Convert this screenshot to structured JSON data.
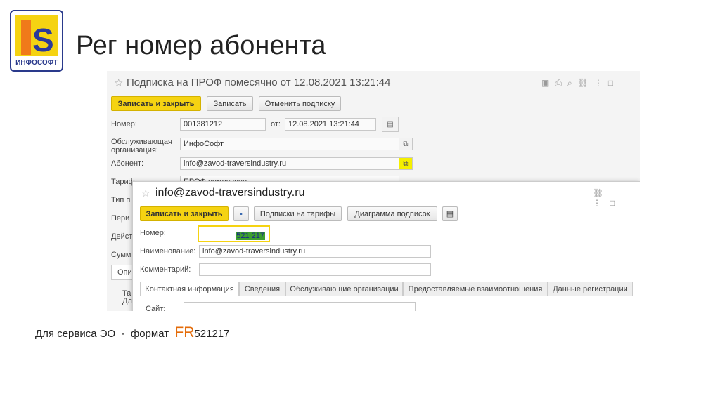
{
  "logo": {
    "text": "ИНФОСОФТ",
    "letters": "IS"
  },
  "slide_title": "Рег номер абонента",
  "main_form": {
    "title": "Подписка на ПРОФ помесячно от 12.08.2021 13:21:44",
    "buttons": {
      "save_close": "Записать и закрыть",
      "save": "Записать",
      "cancel_sub": "Отменить подписку"
    },
    "number_label": "Номер:",
    "number_value": "001381212",
    "from_label": "от:",
    "date_value": "12.08.2021 13:21:44",
    "org_label": "Обслуживающая организация:",
    "org_value": "ИнфоСофт",
    "subscriber_label": "Абонент:",
    "subscriber_value": "info@zavod-traversindustry.ru",
    "tariff_label": "Тариф",
    "tariff_value": "ПРОФ помесячно",
    "hidden_labels": [
      "Тип п",
      "Пери",
      "Дейст",
      "Сумм"
    ],
    "tab_partial": "Опи",
    "table_partial": [
      "Та",
      "Дл"
    ]
  },
  "sub_form": {
    "title": "info@zavod-traversindustry.ru",
    "buttons": {
      "save_close": "Записать и закрыть",
      "tariffs": "Подписки на тарифы",
      "diagram": "Диаграмма подписок"
    },
    "number_label": "Номер:",
    "number_value": "521 217",
    "name_label": "Наименование:",
    "name_value": "info@zavod-traversindustry.ru",
    "comment_label": "Комментарий:",
    "comment_value": "",
    "tabs": [
      "Контактная информация",
      "Сведения",
      "Обслуживающие организации",
      "Предоставляемые взаимоотношения",
      "Данные регистрации"
    ],
    "site_label": "Сайт:"
  },
  "footer": {
    "text": "Для сервиса ЭО  -  формат ",
    "prefix": "FR",
    "code": "521217"
  },
  "colors": {
    "accent_yellow": "#f5d312",
    "highlight_green": "#3c9e2e",
    "fr_orange": "#e46c0a"
  }
}
